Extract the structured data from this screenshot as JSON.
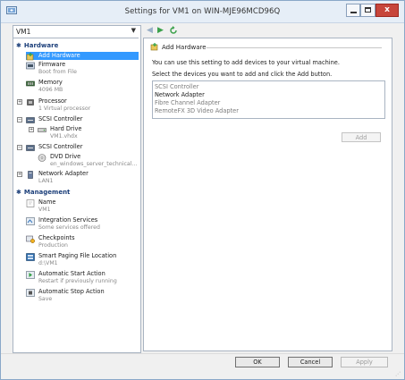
{
  "window": {
    "title": "Settings for VM1 on WIN-MJE96MCD96Q",
    "min_label": "",
    "max_label": "",
    "close_label": "x"
  },
  "vm_selector": {
    "value": "VM1"
  },
  "tree": {
    "hardware_header": "Hardware",
    "management_header": "Management",
    "hardware": [
      {
        "label": "Add Hardware",
        "sub": "",
        "icon": "add-hardware-icon"
      },
      {
        "label": "Firmware",
        "sub": "Boot from File",
        "icon": "firmware-icon"
      },
      {
        "label": "Memory",
        "sub": "4096 MB",
        "icon": "memory-icon"
      },
      {
        "label": "Processor",
        "sub": "1 Virtual processor",
        "icon": "processor-icon"
      },
      {
        "label": "SCSI Controller",
        "sub": "",
        "icon": "scsi-controller-icon"
      },
      {
        "label": "Hard Drive",
        "sub": "VM1.vhdx",
        "icon": "hard-drive-icon"
      },
      {
        "label": "SCSI Controller",
        "sub": "",
        "icon": "scsi-controller-icon"
      },
      {
        "label": "DVD Drive",
        "sub": "en_windows_server_technical...",
        "icon": "dvd-drive-icon"
      },
      {
        "label": "Network Adapter",
        "sub": "LAN1",
        "icon": "network-adapter-icon"
      }
    ],
    "management": [
      {
        "label": "Name",
        "sub": "VM1",
        "icon": "name-icon"
      },
      {
        "label": "Integration Services",
        "sub": "Some services offered",
        "icon": "integration-services-icon"
      },
      {
        "label": "Checkpoints",
        "sub": "Production",
        "icon": "checkpoints-icon"
      },
      {
        "label": "Smart Paging File Location",
        "sub": "d:\\VM1",
        "icon": "smart-paging-icon"
      },
      {
        "label": "Automatic Start Action",
        "sub": "Restart if previously running",
        "icon": "auto-start-icon"
      },
      {
        "label": "Automatic Stop Action",
        "sub": "Save",
        "icon": "auto-stop-icon"
      }
    ]
  },
  "content": {
    "group_title": "Add Hardware",
    "description": "You can use this setting to add devices to your virtual machine.",
    "instruction": "Select the devices you want to add and click the Add button.",
    "devices": [
      "SCSI Controller",
      "Network Adapter",
      "Fibre Channel Adapter",
      "RemoteFX 3D Video Adapter"
    ],
    "add_button": "Add"
  },
  "buttons": {
    "ok": "OK",
    "cancel": "Cancel",
    "apply": "Apply"
  },
  "colors": {
    "accent": "#3399ff",
    "section_header": "#1c3f7a",
    "close": "#c7463b"
  }
}
